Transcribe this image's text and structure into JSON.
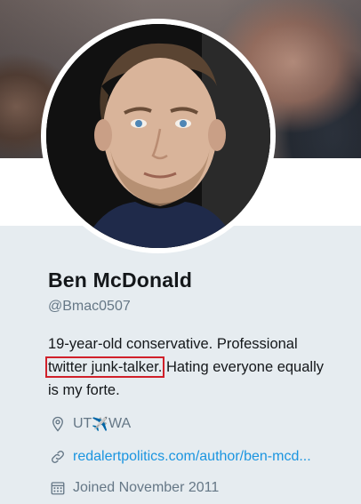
{
  "profile": {
    "name": "Ben McDonald",
    "handle": "@Bmac0507",
    "bio": {
      "part1": "19-year-old conservative. Professional",
      "highlight": "twitter junk-talker.",
      "part2": " Hating everyone equally is my forte."
    },
    "location": {
      "from": "UT",
      "plane": "✈️",
      "to": "WA",
      "icon": "map-pin-icon"
    },
    "website": {
      "text": "redalertpolitics.com/author/ben-mcd...",
      "icon": "link-icon"
    },
    "joined": {
      "text": "Joined November 2011",
      "icon": "calendar-icon"
    }
  },
  "colors": {
    "background": "#e6ecf0",
    "name": "#14171a",
    "secondary_text": "#657786",
    "link": "#1b95e0",
    "highlight_box": "#d0202a"
  }
}
